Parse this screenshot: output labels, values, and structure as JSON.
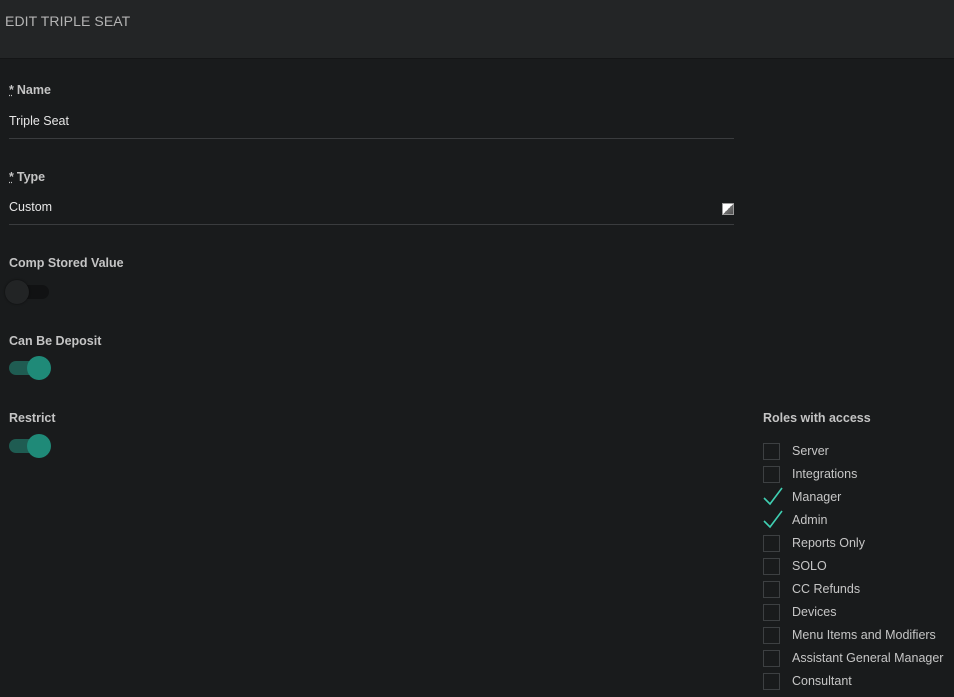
{
  "header": {
    "title": "EDIT TRIPLE SEAT"
  },
  "fields": {
    "required_mark": "*",
    "name": {
      "label": "Name",
      "value": "Triple Seat"
    },
    "type": {
      "label": "Type",
      "value": "Custom"
    }
  },
  "toggles": {
    "comp_stored_value": {
      "label": "Comp Stored Value",
      "on": false
    },
    "can_be_deposit": {
      "label": "Can Be Deposit",
      "on": true
    },
    "restrict": {
      "label": "Restrict",
      "on": true
    }
  },
  "roles": {
    "title": "Roles with access",
    "items": [
      {
        "label": "Server",
        "checked": false
      },
      {
        "label": "Integrations",
        "checked": false
      },
      {
        "label": "Manager",
        "checked": true
      },
      {
        "label": "Admin",
        "checked": true
      },
      {
        "label": "Reports Only",
        "checked": false
      },
      {
        "label": "SOLO",
        "checked": false
      },
      {
        "label": "CC Refunds",
        "checked": false
      },
      {
        "label": "Devices",
        "checked": false
      },
      {
        "label": "Menu Items and Modifiers",
        "checked": false
      },
      {
        "label": "Assistant General Manager",
        "checked": false
      },
      {
        "label": "Consultant",
        "checked": false
      }
    ]
  },
  "colors": {
    "accent": "#1f8a78",
    "check": "#3fcfb2"
  }
}
